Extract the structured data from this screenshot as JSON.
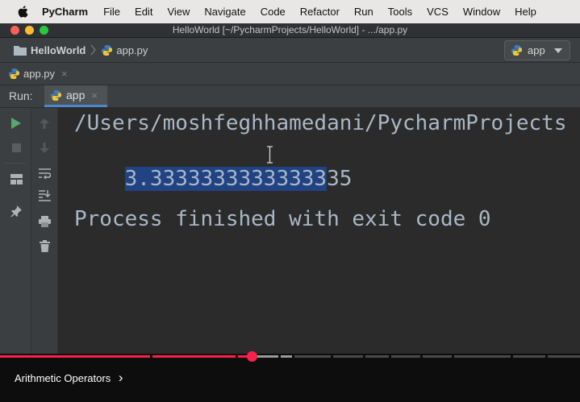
{
  "menubar": {
    "app_name": "PyCharm",
    "items": [
      "File",
      "Edit",
      "View",
      "Navigate",
      "Code",
      "Refactor",
      "Run",
      "Tools",
      "VCS",
      "Window",
      "Help"
    ]
  },
  "window": {
    "title": "HelloWorld [~/PycharmProjects/HelloWorld] - .../app.py"
  },
  "navbar": {
    "project": "HelloWorld",
    "file": "app.py",
    "run_config": "app"
  },
  "editor_tab": {
    "label": "app.py",
    "close": "×"
  },
  "run_window": {
    "label": "Run:",
    "tab_label": "app",
    "tab_close": "×"
  },
  "console": {
    "path_line": "/Users/moshfeghhamedani/PycharmProjects",
    "output_selected": "3.33333333333333",
    "output_rest": "35",
    "exit_line": "Process finished with exit code 0"
  },
  "video": {
    "chapter": "Arithmetic Operators",
    "chapter_chevron": "›",
    "progress": 0.434
  },
  "colors": {
    "progress_red": "#ff1f48",
    "selection": "#214283",
    "console_text": "#a9b7c6",
    "run_green": "#59a869"
  }
}
